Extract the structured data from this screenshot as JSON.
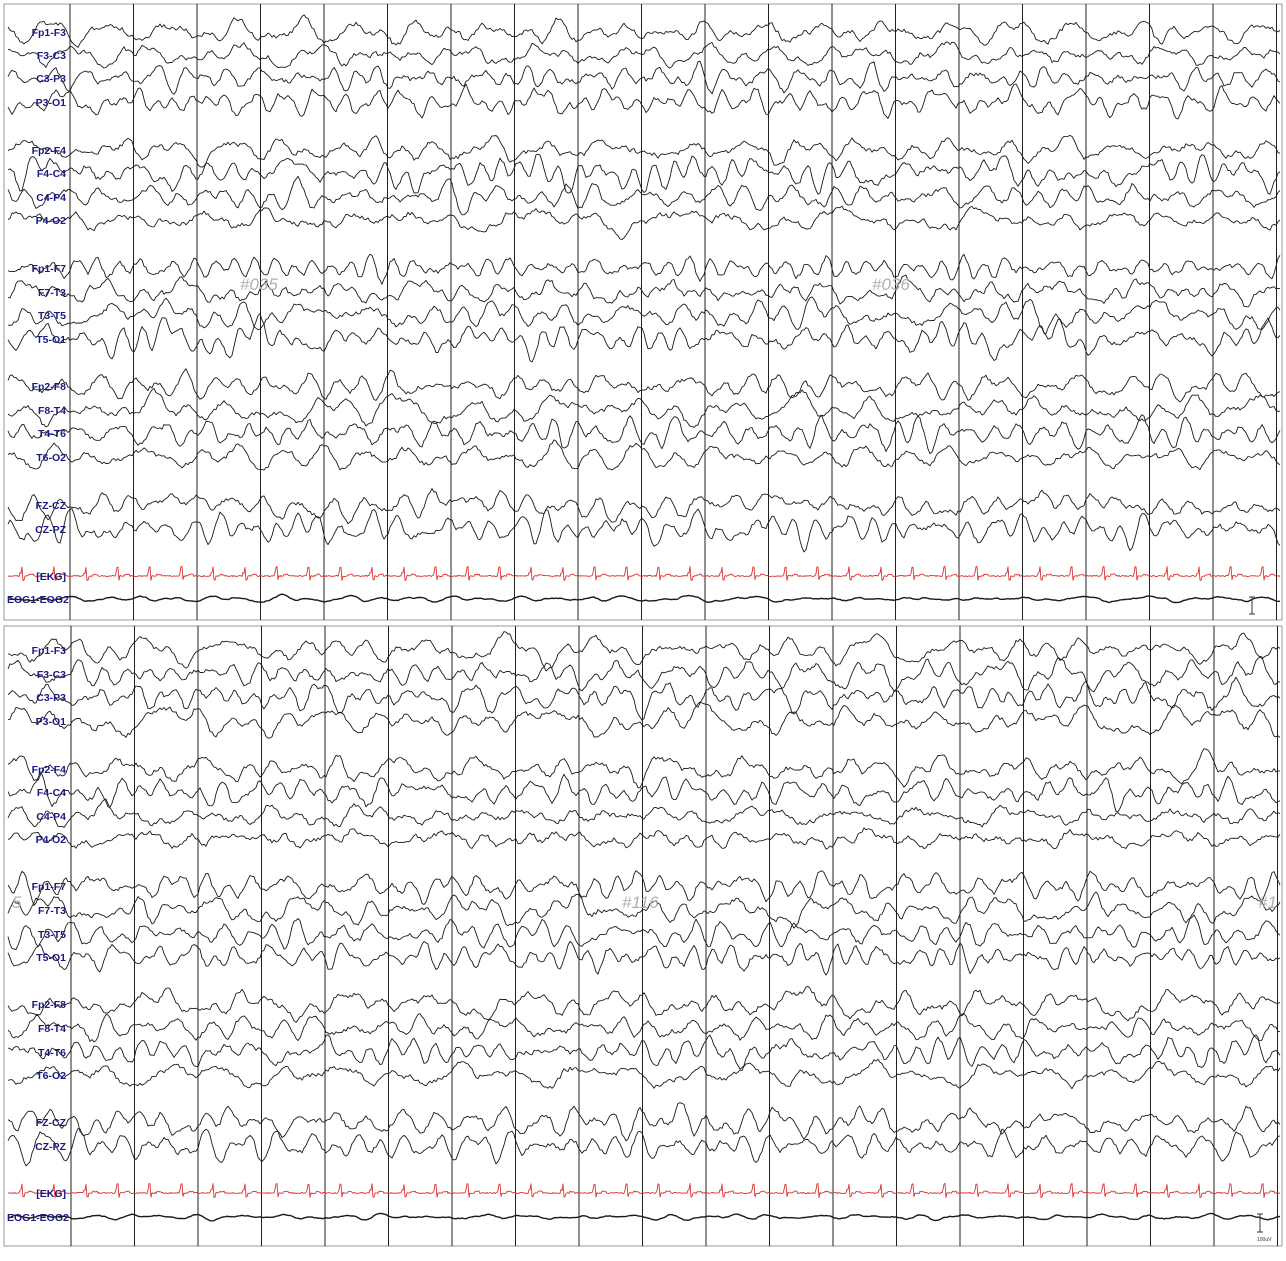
{
  "panels": [
    {
      "id": "panel-top",
      "channels": [
        {
          "label": "Fp1-F3"
        },
        {
          "label": "F3-C3"
        },
        {
          "label": "C3-P3"
        },
        {
          "label": "P3-O1"
        },
        {
          "label": "Fp2-F4"
        },
        {
          "label": "F4-C4"
        },
        {
          "label": "C4-P4"
        },
        {
          "label": "P4-O2"
        },
        {
          "label": "Fp1-F7"
        },
        {
          "label": "F7-T3"
        },
        {
          "label": "T3-T5"
        },
        {
          "label": "T5-O1"
        },
        {
          "label": "Fp2-F8"
        },
        {
          "label": "F8-T4"
        },
        {
          "label": "T4-T6"
        },
        {
          "label": "T6-O2"
        },
        {
          "label": "FZ-CZ"
        },
        {
          "label": "CZ-PZ"
        },
        {
          "label": "[EKG]",
          "color": "#e03030"
        },
        {
          "label": "EOG1-EOG2"
        }
      ],
      "page_markers": [
        "#035",
        "#036"
      ],
      "scale_label": ""
    },
    {
      "id": "panel-bottom",
      "channels": [
        {
          "label": "Fp1-F3"
        },
        {
          "label": "F3-C3"
        },
        {
          "label": "C3-P3"
        },
        {
          "label": "P3-O1"
        },
        {
          "label": "Fp2-F4"
        },
        {
          "label": "F4-C4"
        },
        {
          "label": "C4-P4"
        },
        {
          "label": "P4-O2"
        },
        {
          "label": "Fp1-F7"
        },
        {
          "label": "F7-T3"
        },
        {
          "label": "T3-T5"
        },
        {
          "label": "T5-O1"
        },
        {
          "label": "Fp2-F8"
        },
        {
          "label": "F8-T4"
        },
        {
          "label": "T4-T6"
        },
        {
          "label": "T6-O2"
        },
        {
          "label": "FZ-CZ"
        },
        {
          "label": "CZ-PZ"
        },
        {
          "label": "[EKG]",
          "color": "#e03030"
        },
        {
          "label": "EOG1-EOG2"
        }
      ],
      "page_markers": [
        "5",
        "#116",
        "#1"
      ],
      "scale_label": "100uV"
    }
  ],
  "colors": {
    "trace": "#1a1a1a",
    "ekg": "#e03030",
    "label": "#1a1a80",
    "gridline": "#202020",
    "marker": "#b0b0b0"
  }
}
